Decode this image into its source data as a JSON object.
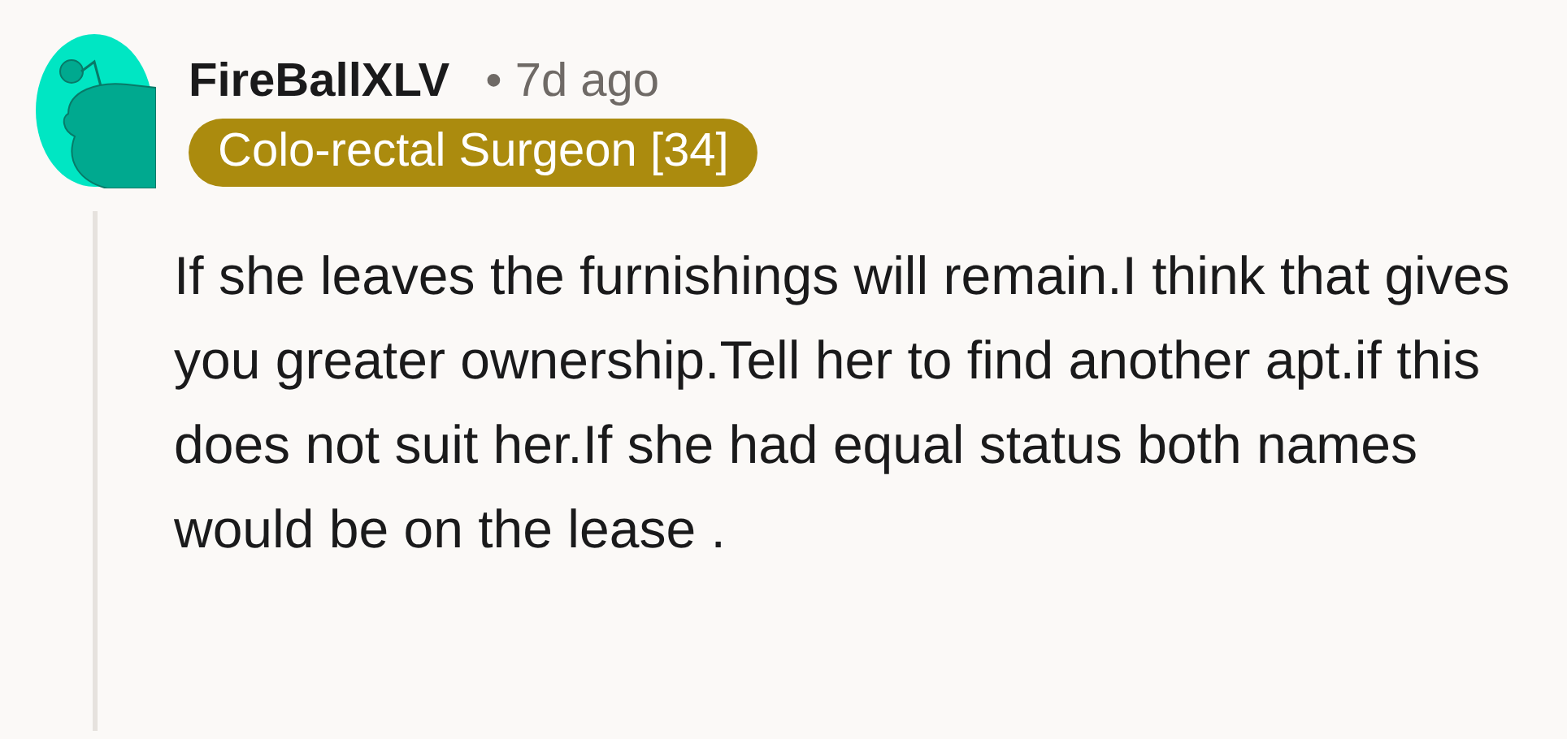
{
  "comment": {
    "author": "FireBallXLV",
    "separator": "•",
    "time": "7d ago",
    "flair": {
      "text": "Colo-rectal Surgeon [34]",
      "color": "#ab8b0e"
    },
    "body": "If she leaves the furnishings will remain.I think that gives you greater ownership.Tell her to find another apt.if this does not suit her.If she had equal status both names would be on the lease ."
  }
}
